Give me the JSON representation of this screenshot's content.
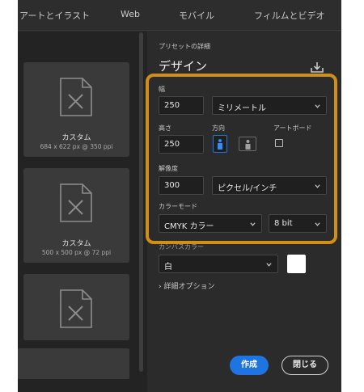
{
  "nav": {
    "tabs": [
      "アートとイラスト",
      "Web",
      "モバイル",
      "フィルムとビデオ"
    ]
  },
  "presets": [
    {
      "title": "カスタム",
      "subtitle": "684 x 622 px @ 350 ppi"
    },
    {
      "title": "カスタム",
      "subtitle": "500 x 500 px @ 72 ppi"
    },
    {
      "title": "",
      "subtitle": ""
    }
  ],
  "details": {
    "section_label": "プリセットの詳細",
    "preset_name": "デザイン",
    "width_label": "幅",
    "width_value": "250",
    "unit_value": "ミリメートル",
    "height_label": "高さ",
    "height_value": "250",
    "orientation_label": "方向",
    "artboard_label": "アートボード",
    "resolution_label": "解像度",
    "resolution_value": "300",
    "resolution_unit": "ピクセル/インチ",
    "color_mode_label": "カラーモード",
    "color_mode_value": "CMYK カラー",
    "bit_depth_value": "8 bit",
    "canvas_color_label": "カンバスカラー",
    "canvas_color_value": "白",
    "advanced_options": "詳細オプション"
  },
  "buttons": {
    "create": "作成",
    "close": "閉じる"
  },
  "colors": {
    "accent": "#1e74e1",
    "highlight": "#d28f17"
  }
}
